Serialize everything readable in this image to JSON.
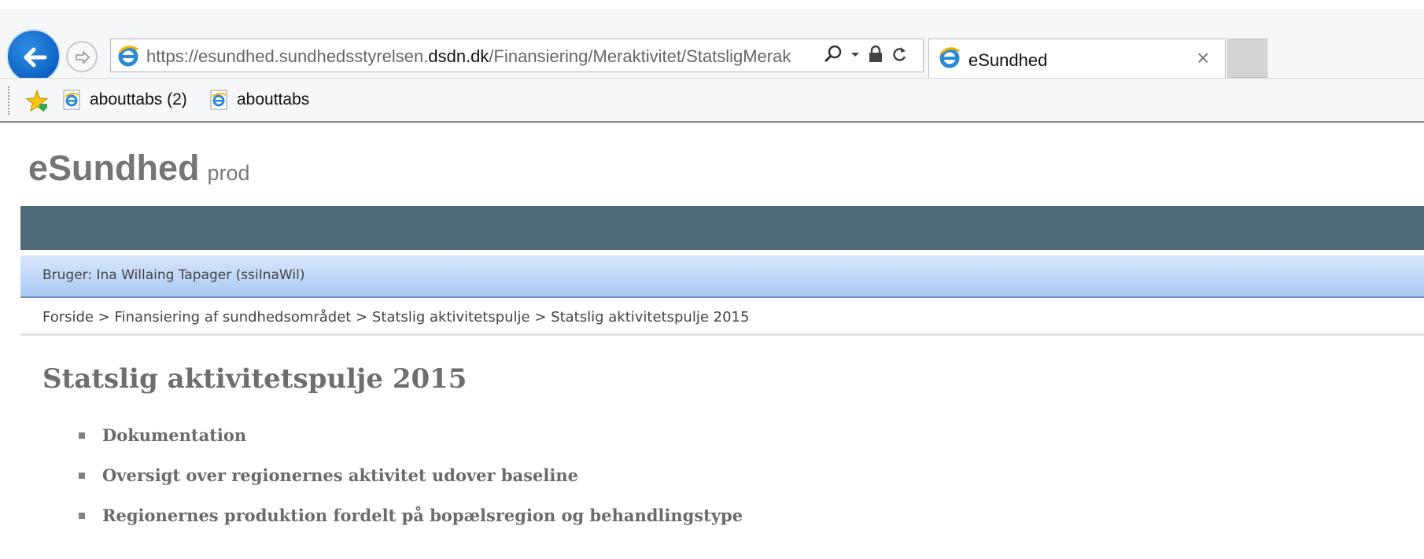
{
  "browser": {
    "url_prefix": "https://esundhed.sundhedsstyrelsen.",
    "url_host": "dsdn.dk",
    "url_suffix": "/Finansiering/Meraktivitet/StatsligMerak",
    "tab_title": "eSundhed",
    "tab_close": "×",
    "favorites": [
      {
        "label": "abouttabs (2)",
        "icon": "ie-page-icon"
      },
      {
        "label": "abouttabs",
        "icon": "ie-page-icon"
      }
    ],
    "icons": {
      "back": "back-arrow-icon",
      "forward": "forward-arrow-icon",
      "search": "search-icon",
      "dropdown": "chevron-down-icon",
      "lock": "lock-icon",
      "refresh": "refresh-icon",
      "favorites": "favorites-star-icon"
    }
  },
  "site": {
    "title": "eSundhed",
    "env": "prod",
    "user": "Bruger: Ina Willaing Tapager (ssiInaWil)",
    "breadcrumb": "Forside > Finansiering af sundhedsområdet > Statslig aktivitetspulje > Statslig aktivitetspulje 2015",
    "heading": "Statslig aktivitetspulje 2015",
    "links": [
      "Dokumentation",
      "Oversigt over regionernes aktivitet udover baseline",
      "Regionernes produktion fordelt på bopælsregion og behandlingstype"
    ]
  },
  "colors": {
    "navbar": "#4f6b79",
    "userbar": "#a9c8f3",
    "heading": "#6e6e6e",
    "back_button": "#0c62c4"
  }
}
